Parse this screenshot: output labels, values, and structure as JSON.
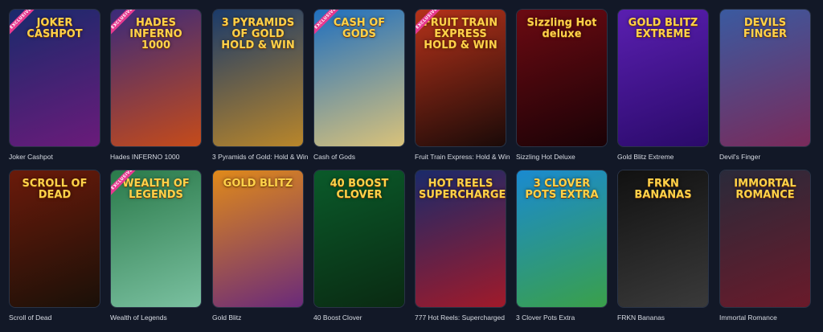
{
  "games": [
    {
      "title": "Joker Cashpot",
      "logo": "JOKER CASHPOT",
      "badge": "EXCLUSIVE",
      "bg": [
        "#1a2a6c",
        "#6a1b7a"
      ]
    },
    {
      "title": "Hades INFERNO 1000",
      "logo": "HADES INFERNO 1000",
      "badge": "EXCLUSIVE",
      "bg": [
        "#3b2a7a",
        "#c54b1a"
      ]
    },
    {
      "title": "3 Pyramids of Gold: Hold & Win",
      "logo": "3 PYRAMIDS OF GOLD HOLD & WIN",
      "badge": "",
      "bg": [
        "#1a3a6a",
        "#b9862a"
      ]
    },
    {
      "title": "Cash of Gods",
      "logo": "CASH OF GODS",
      "badge": "EXCLUSIVE",
      "bg": [
        "#1f6fbf",
        "#d9c27a"
      ]
    },
    {
      "title": "Fruit Train Express: Hold & Win",
      "logo": "FRUIT TRAIN EXPRESS HOLD & WIN",
      "badge": "EXCLUSIVE",
      "bg": [
        "#b5321a",
        "#1a0a08"
      ]
    },
    {
      "title": "Sizzling Hot Deluxe",
      "logo": "Sizzling Hot deluxe",
      "badge": "",
      "bg": [
        "#6b0a12",
        "#1a0206"
      ]
    },
    {
      "title": "Gold Blitz Extreme",
      "logo": "GOLD BLITZ EXTREME",
      "badge": "",
      "bg": [
        "#5a1fb0",
        "#2a0a6a"
      ]
    },
    {
      "title": "Devil's Finger",
      "logo": "DEVILS FINGER",
      "badge": "",
      "bg": [
        "#3a5aa0",
        "#7a2a5a"
      ]
    },
    {
      "title": "Scroll of Dead",
      "logo": "SCROLL OF DEAD",
      "badge": "",
      "bg": [
        "#6a1a0a",
        "#1a1008"
      ]
    },
    {
      "title": "Wealth of Legends",
      "logo": "WEALTH OF LEGENDS",
      "badge": "EXCLUSIVE",
      "bg": [
        "#2a7a4a",
        "#7ac0a0"
      ]
    },
    {
      "title": "Gold Blitz",
      "logo": "GOLD BLITZ",
      "badge": "",
      "bg": [
        "#e08a1a",
        "#6a2a7a"
      ]
    },
    {
      "title": "40 Boost Clover",
      "logo": "40 BOOST CLOVER",
      "badge": "",
      "bg": [
        "#0a5a2a",
        "#0a2a12"
      ]
    },
    {
      "title": "777 Hot Reels: Supercharged",
      "logo": "HOT REELS SUPERCHARGED",
      "badge": "",
      "bg": [
        "#1a2a6a",
        "#a01a2a"
      ]
    },
    {
      "title": "3 Clover Pots Extra",
      "logo": "3 CLOVER POTS EXTRA",
      "badge": "",
      "bg": [
        "#1a8ad0",
        "#3aa04a"
      ]
    },
    {
      "title": "FRKN Bananas",
      "logo": "FRKN BANANAS",
      "badge": "",
      "bg": [
        "#111111",
        "#3a3a3a"
      ]
    },
    {
      "title": "Immortal Romance",
      "logo": "IMMORTAL ROMANCE",
      "badge": "",
      "bg": [
        "#2a2a3a",
        "#6a1a2a"
      ]
    }
  ]
}
